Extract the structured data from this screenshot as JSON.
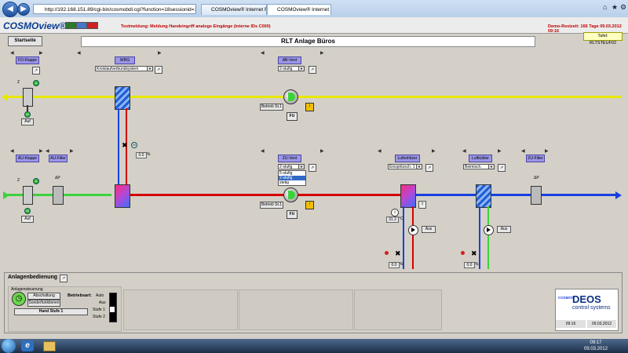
{
  "browser": {
    "url": "http://192.168.151.89/cgi-bin/cosmobdi.cgi?function=18sessionid=1035276298&gr",
    "tabs": [
      "COSMOview® Internet Fer...",
      "COSMOview® Internet Fer..."
    ]
  },
  "header": {
    "logo": "COSMOview®",
    "alarm": "Textmeldung: Meldung Handeingriff analoge Eingänge (interne IDs C000)",
    "demo": "Demo-Restzeit: 166 Tage     09.03.2012 09:16",
    "tablet": "Tafel: RLTSTEUF02"
  },
  "page": {
    "start_button": "Startseite",
    "title": "RLT Anlage Büros"
  },
  "blocks": {
    "fo_klappe": "FO-Klappe",
    "wrg": "WRG",
    "wrg_select": "Kreislaufverbundsystem",
    "ab_vent": "AB-Vent",
    "ab_select": "2-stufig",
    "au_klappe": "AU-Klappe",
    "au_filter": "AU-Filter",
    "zu_vent": "ZU-Vent",
    "zu_select": "2-stufig",
    "zu_options": [
      "5-stufig",
      "2-stufig",
      "stetig"
    ],
    "lufterhitzer": "Lufterhitzer",
    "lufterhitzer_select": "Einspritzsch. 1",
    "luftkuehler": "Luftkühler",
    "luftkuehler_select": "Beimisch.",
    "zu_filter": "ZU-Filter"
  },
  "values": {
    "fo_state": "Auf",
    "au_state": "Auf",
    "ab_status": "Betrieb St.1",
    "zu_status": "Betrieb St.1",
    "fu": "FU",
    "wrg_valve": "0.0",
    "pct": "%",
    "temp": "31.2",
    "deg": "°C",
    "heiz_pump": "Aus",
    "kuehl_pump": "Aus",
    "heiz_valve": "0.0",
    "kuehl_valve": "0.0",
    "m": "M",
    "t": "T",
    "dp": "ΔP",
    "z": "Z",
    "a": "A"
  },
  "panel": {
    "title": "Anlagenbedienung",
    "group": "Anlagensteuerung",
    "btn1": "Abschaltung Vent.",
    "btn2": "Sonderfunktionen",
    "betriebsart": "Betriebsart:",
    "modes": [
      "Auto",
      "Aus",
      "Stufe 1",
      "Stufe 2"
    ],
    "hand": "Hand Stufe 1",
    "deos_small": "COSMOS",
    "deos": "DEOS",
    "deos_sub": "control systems",
    "time": "09:16",
    "date": "09.03.2012"
  },
  "taskbar": {
    "time": "09:17",
    "date": "09.03.2012"
  },
  "colors": {
    "exhaust": "#e8e800",
    "supply_in": "#3cd23c",
    "supply_hot": "#d40000",
    "supply_out": "#1840e0"
  }
}
